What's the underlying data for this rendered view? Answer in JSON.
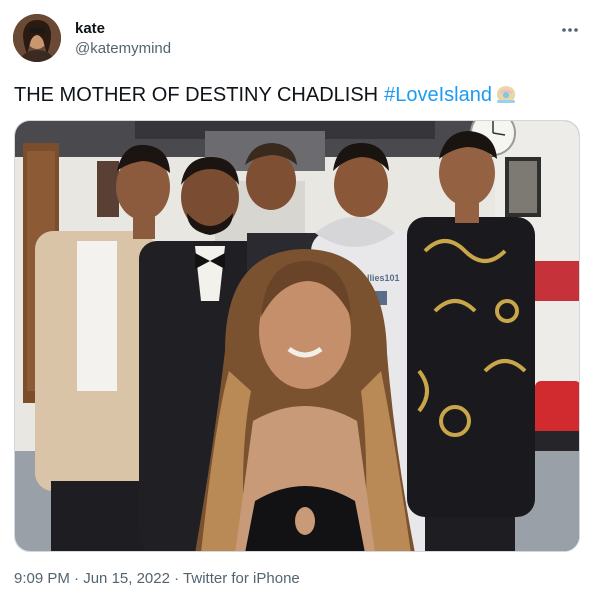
{
  "author": {
    "name": "kate",
    "handle": "@katemymind"
  },
  "tweet": {
    "text": "THE MOTHER OF DESTINY CHADLISH",
    "hashtag": "#LoveIsland"
  },
  "meta": {
    "time": "9:09 PM",
    "separator1": " · ",
    "date": "Jun 15, 2022",
    "separator2": " · ",
    "source": "Twitter for iPhone"
  },
  "media": {
    "hoodie_text": "wellies101"
  },
  "colors": {
    "link": "#1d9bf0",
    "secondary_text": "#536471",
    "primary_text": "#0f1419"
  },
  "icons": {
    "more": "more-horizontal-icon",
    "hashflag": "love-island-hashflag-icon"
  }
}
